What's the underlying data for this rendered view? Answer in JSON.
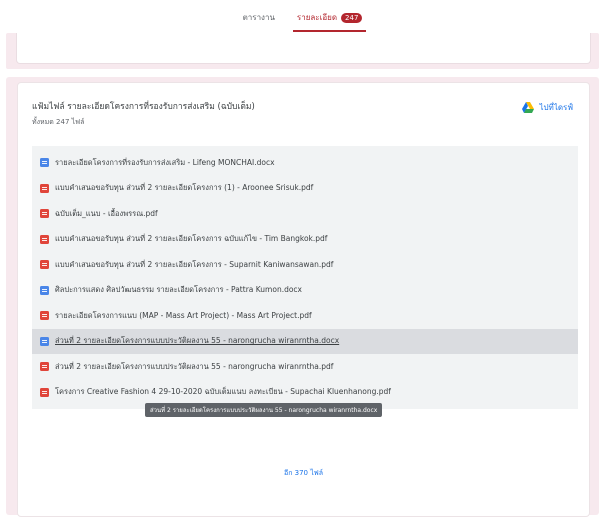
{
  "tabs": [
    {
      "label": "ตารางาน",
      "active": false
    },
    {
      "label": "รายละเอียด",
      "active": true,
      "badge": "247"
    }
  ],
  "panel": {
    "title": "แฟ้มไฟล์ รายละเอียดโครงการที่รองรับการส่งเสริม (ฉบับเต็ม)",
    "count": "ทั้งหมด 247 ไฟล์",
    "drive_link": "ไปที่ไดรฟ์"
  },
  "files": [
    {
      "type": "doc",
      "name": "รายละเอียดโครงการที่รองรับการส่งเสริม - Lifeng MONCHAI.docx"
    },
    {
      "type": "pdf",
      "name": "แบบคำเสนอขอรับทุน ส่วนที่ 2 รายละเอียดโครงการ (1) - Aroonee Srisuk.pdf"
    },
    {
      "type": "pdf",
      "name": "ฉบับเต็ม_แนบ - เอื้องพรรณ.pdf"
    },
    {
      "type": "pdf",
      "name": "แบบคำเสนอขอรับทุน ส่วนที่ 2 รายละเอียดโครงการ ฉบับแก้ไข - Tim Bangkok.pdf"
    },
    {
      "type": "pdf",
      "name": "แบบคำเสนอขอรับทุน ส่วนที่ 2 รายละเอียดโครงการ - Suparnit Kaniwansawan.pdf"
    },
    {
      "type": "doc",
      "name": "ศิลปะการแสดง ศิลปวัฒนธรรม รายละเอียดโครงการ - Pattra Kumon.docx"
    },
    {
      "type": "pdf",
      "name": "รายละเอียดโครงการแนบ (MAP - Mass Art Project) - Mass Art Project.pdf"
    },
    {
      "type": "doc",
      "name": "ส่วนที่ 2 รายละเอียดโครงการแบบประวัติผลงาน 55 - narongrucha wiranrntha.docx",
      "highlight": true
    },
    {
      "type": "pdf",
      "name": "ส่วนที่ 2 รายละเอียดโครงการแบบประวัติผลงาน 55 - narongrucha wiranrntha.pdf"
    },
    {
      "type": "pdf",
      "name": "โครงการ Creative Fashion 4 29-10-2020 ฉบับเต็มแนบ ลงทะเบียน - Supachai Kluenhanong.pdf"
    }
  ],
  "tooltip": "ส่วนที่ 2 รายละเอียดโครงการแบบประวัติผลงาน 55 - narongrucha wiranrntha.docx",
  "more_label": "อีก 370 ไฟล์",
  "colors": {
    "accent": "#b3262e",
    "doc": "#4a86e8",
    "pdf": "#e0453a",
    "link": "#1a73e8"
  }
}
